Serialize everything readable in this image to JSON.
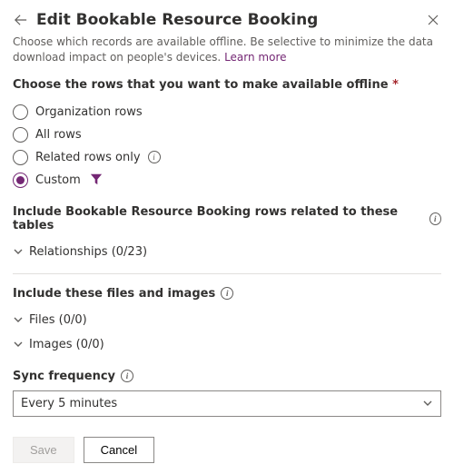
{
  "header": {
    "title": "Edit Bookable Resource Booking",
    "subtitle": "Choose which records are available offline. Be selective to minimize the data download impact on people's devices.",
    "learn_more": "Learn more"
  },
  "rows_section": {
    "label": "Choose the rows that you want to make available offline",
    "required": "*",
    "options": {
      "organization": "Organization rows",
      "all": "All rows",
      "related": "Related rows only",
      "custom": "Custom"
    }
  },
  "include_related": {
    "label": "Include Bookable Resource Booking rows related to these tables",
    "relationships": "Relationships (0/23)"
  },
  "include_files": {
    "label": "Include these files and images",
    "files": "Files (0/0)",
    "images": "Images (0/0)"
  },
  "sync": {
    "label": "Sync frequency",
    "value": "Every 5 minutes"
  },
  "footer": {
    "save": "Save",
    "cancel": "Cancel"
  }
}
